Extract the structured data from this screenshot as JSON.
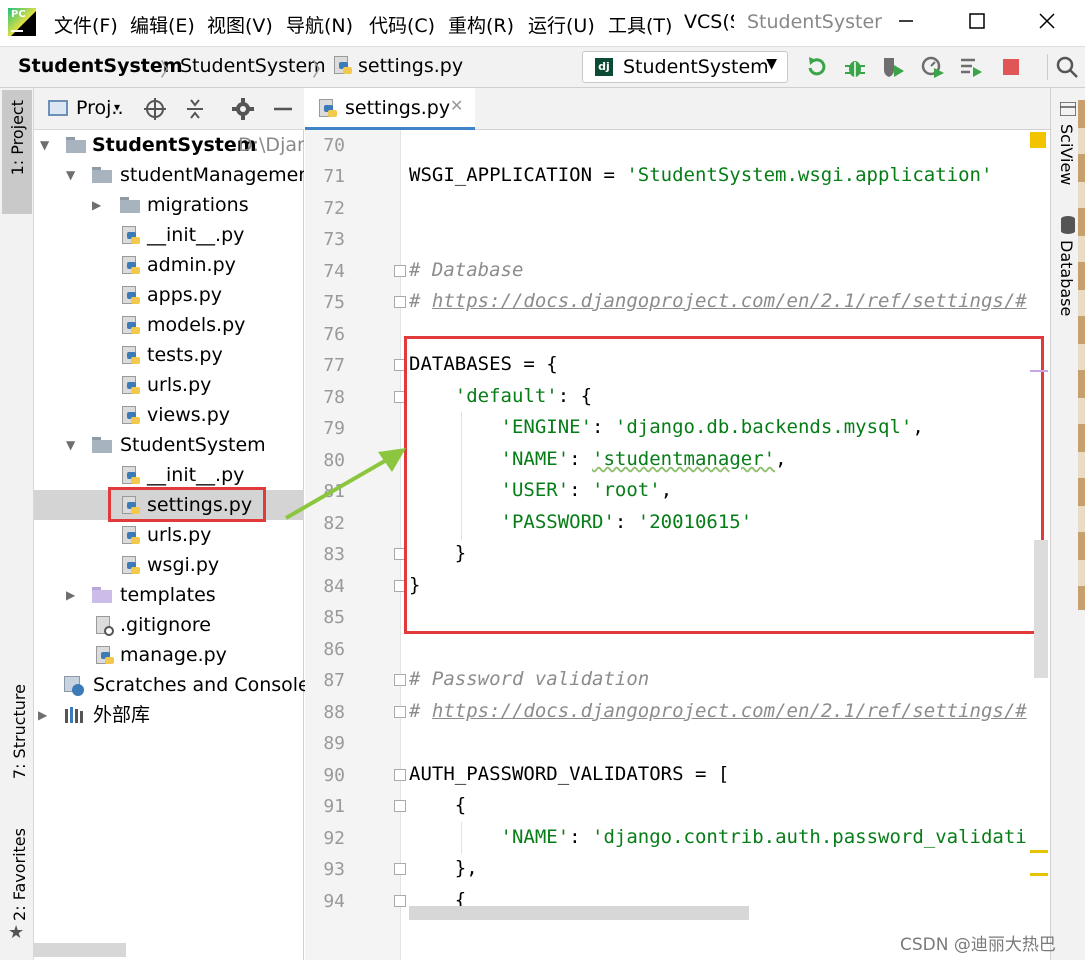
{
  "titlebar": {
    "menus": [
      "文件(F)",
      "编辑(E)",
      "视图(V)",
      "导航(N)",
      "代码(C)",
      "重构(R)",
      "运行(U)",
      "工具(T)",
      "VCS(S"
    ],
    "window_title": "StudentSyster",
    "logo_text": "PC"
  },
  "navbar": {
    "breadcrumbs": [
      "StudentSystem",
      "StudentSystem",
      "settings.py"
    ],
    "run_config": "StudentSystem",
    "run_config_badge": "dj"
  },
  "left_strip": {
    "project_tab": "1: Project",
    "structure_tab": "7: Structure",
    "favorites_tab": "2: Favorites"
  },
  "project_panel": {
    "header_label": "Proj..",
    "tree": [
      {
        "label": "StudentSystem",
        "suffix": "D:\\Djan"
      },
      {
        "label": "studentManagement"
      },
      {
        "label": "migrations"
      },
      {
        "label": "__init__.py"
      },
      {
        "label": "admin.py"
      },
      {
        "label": "apps.py"
      },
      {
        "label": "models.py"
      },
      {
        "label": "tests.py"
      },
      {
        "label": "urls.py"
      },
      {
        "label": "views.py"
      },
      {
        "label": "StudentSystem"
      },
      {
        "label": "__init__.py"
      },
      {
        "label": "settings.py"
      },
      {
        "label": "urls.py"
      },
      {
        "label": "wsgi.py"
      },
      {
        "label": "templates"
      },
      {
        "label": ".gitignore"
      },
      {
        "label": "manage.py"
      },
      {
        "label": "Scratches and Consoles"
      },
      {
        "label": "外部库"
      }
    ]
  },
  "editor": {
    "tab_label": "settings.py",
    "lines": [
      {
        "n": "70"
      },
      {
        "n": "71"
      },
      {
        "n": "72"
      },
      {
        "n": "73"
      },
      {
        "n": "74"
      },
      {
        "n": "75"
      },
      {
        "n": "76"
      },
      {
        "n": "77"
      },
      {
        "n": "78"
      },
      {
        "n": "79"
      },
      {
        "n": "80"
      },
      {
        "n": "81"
      },
      {
        "n": "82"
      },
      {
        "n": "83"
      },
      {
        "n": "84"
      },
      {
        "n": "85"
      },
      {
        "n": "86"
      },
      {
        "n": "87"
      },
      {
        "n": "88"
      },
      {
        "n": "89"
      },
      {
        "n": "90"
      },
      {
        "n": "91"
      },
      {
        "n": "92"
      },
      {
        "n": "93"
      },
      {
        "n": "94"
      }
    ],
    "code": {
      "l71a": "WSGI_APPLICATION = ",
      "l71b": "'StudentSystem.wsgi.application'",
      "l74": "# Database",
      "l75a": "# ",
      "l75b": "https://docs.djangoproject.com/en/2.1/ref/settings/#",
      "l77": "DATABASES = {",
      "l78a": "    ",
      "l78b": "'default'",
      "l78c": ": {",
      "l79a": "        ",
      "l79b": "'ENGINE'",
      "l79c": ": ",
      "l79d": "'django.db.backends.mysql'",
      "l79e": ",",
      "l80a": "        ",
      "l80b": "'NAME'",
      "l80c": ": ",
      "l80d": "'studentmanager'",
      "l80e": ",",
      "l81a": "        ",
      "l81b": "'USER'",
      "l81c": ": ",
      "l81d": "'root'",
      "l81e": ",",
      "l82a": "        ",
      "l82b": "'PASSWORD'",
      "l82c": ": ",
      "l82d": "'20010615'",
      "l83": "    }",
      "l84": "}",
      "l87": "# Password validation",
      "l88a": "# ",
      "l88b": "https://docs.djangoproject.com/en/2.1/ref/settings/#",
      "l90": "AUTH_PASSWORD_VALIDATORS = [",
      "l91": "    {",
      "l92a": "        ",
      "l92b": "'NAME'",
      "l92c": ": ",
      "l92d": "'django.contrib.auth.password_validati",
      "l93": "    },",
      "l94": "    {"
    }
  },
  "right_strip": {
    "sciview": "SciView",
    "database": "Database"
  },
  "watermark": "CSDN @迪丽大热巴",
  "colors": {
    "string": "#067d17",
    "comment": "#8c8c8c",
    "highlight_box": "#e03a3a",
    "arrow": "#8cc63f",
    "selection": "#d4d4d4"
  }
}
